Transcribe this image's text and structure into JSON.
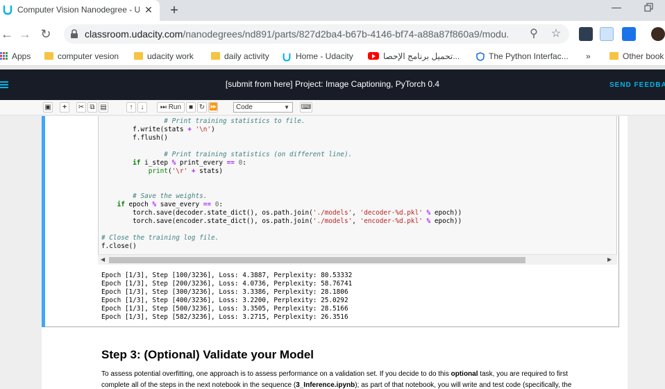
{
  "browser": {
    "tab_title": "Computer Vision Nanodegree - U",
    "url_host": "classroom.udacity.com",
    "url_path": "/nanodegrees/nd891/parts/827d2ba4-b67b-4146-bf74-a88a87f860a9/modu...",
    "bookmarks": [
      {
        "label": "Apps",
        "icon": "apps-grid-icon"
      },
      {
        "label": "computer vesion",
        "icon": "folder-icon"
      },
      {
        "label": "udacity work",
        "icon": "folder-icon"
      },
      {
        "label": "daily activity",
        "icon": "folder-icon"
      },
      {
        "label": "Home - Udacity",
        "icon": "udacity-icon"
      },
      {
        "label": "تحميل برنامج الإحصا...",
        "icon": "youtube-icon"
      },
      {
        "label": "The Python Interfac...",
        "icon": "shield-icon"
      },
      {
        "label": "»",
        "icon": "more-icon"
      },
      {
        "label": "Other book",
        "icon": "folder-icon"
      }
    ]
  },
  "header": {
    "title": "[submit from here] Project: Image Captioning, PyTorch 0.4",
    "send_feedback": "SEND FEEDBACK"
  },
  "jupyter": {
    "run_label": "Run",
    "cell_type": "Code"
  },
  "code_lines": [
    "        # Print training statistics to file.",
    "        f.write(stats + '\\n')",
    "        f.flush()",
    "",
    "        # Print training statistics (on different line).",
    "        if i_step % print_every == 0:",
    "            print('\\r' + stats)",
    "",
    "",
    "    # Save the weights.",
    "    if epoch % save_every == 0:",
    "        torch.save(decoder.state_dict(), os.path.join('./models', 'decoder-%d.pkl' % epoch))",
    "        torch.save(encoder.state_dict(), os.path.join('./models', 'encoder-%d.pkl' % epoch))",
    "",
    "# Close the training log file.",
    "f.close()"
  ],
  "output_lines": [
    "Epoch [1/3], Step [100/3236], Loss: 4.3887, Perplexity: 80.53332",
    "Epoch [1/3], Step [200/3236], Loss: 4.0736, Perplexity: 58.76741",
    "Epoch [1/3], Step [300/3236], Loss: 3.3386, Perplexity: 28.1806",
    "Epoch [1/3], Step [400/3236], Loss: 3.2200, Perplexity: 25.0292",
    "Epoch [1/3], Step [500/3236], Loss: 3.3505, Perplexity: 28.5166",
    "Epoch [1/3], Step [582/3236], Loss: 3.2715, Perplexity: 26.3516"
  ],
  "markdown": {
    "heading": "Step 3: (Optional) Validate your Model",
    "p1_a": "To assess potential overfitting, one approach is to assess performance on a validation set. If you decide to do this ",
    "p1_b": "optional",
    "p1_c": " task, you are required to first",
    "p2_a": "complete all of the steps in the next notebook in the sequence (",
    "p2_b": "3_Inference.ipynb",
    "p2_c": "); as part of that notebook, you will write and test code (specifically, the"
  },
  "colors": {
    "udacity_header": "#171c26",
    "accent": "#02b3e4",
    "cell_selected_bar": "#42a5f5"
  }
}
